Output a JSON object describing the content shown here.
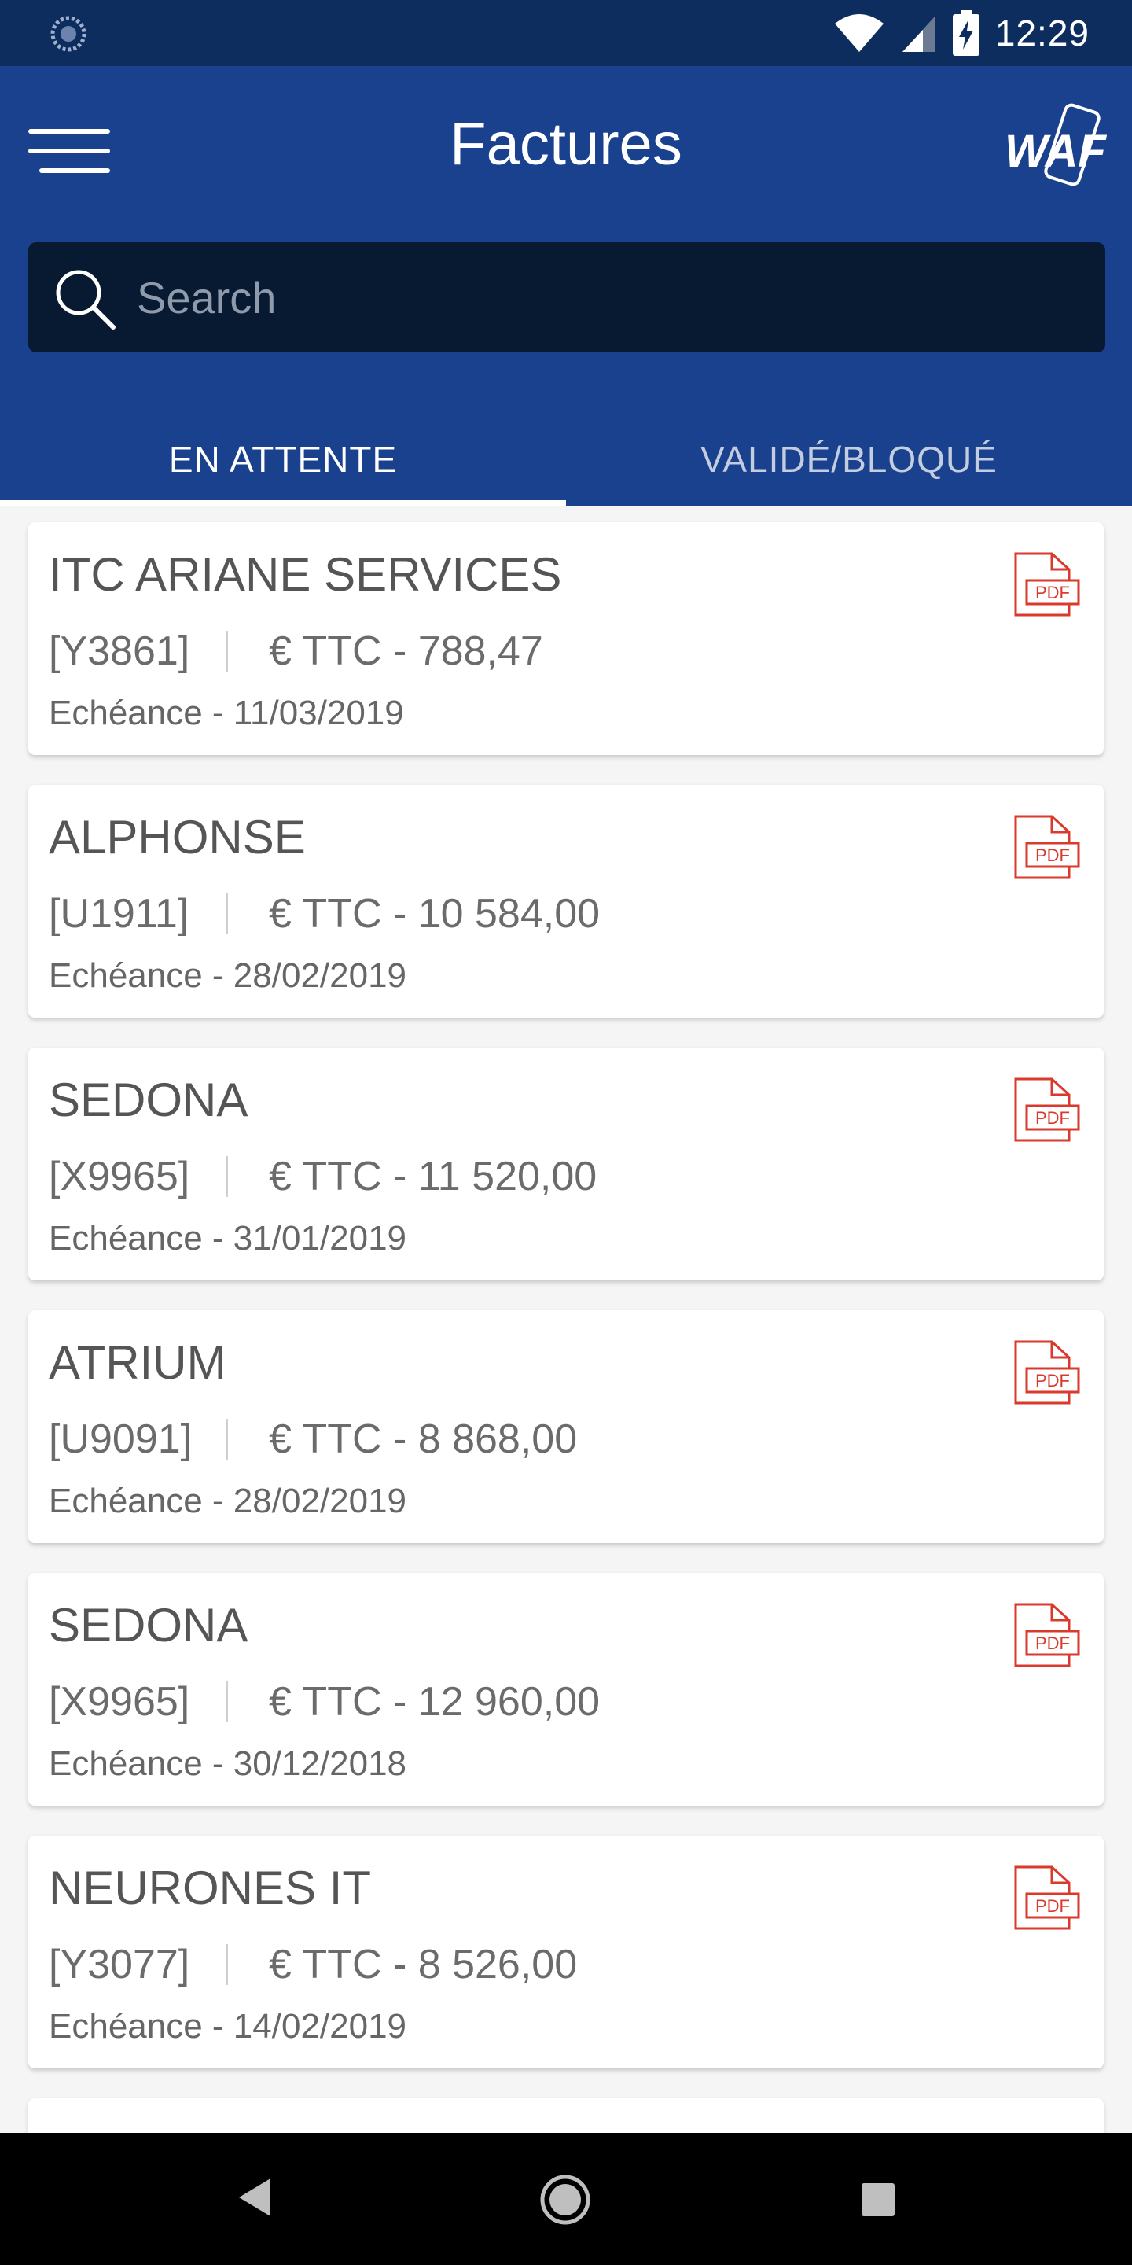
{
  "status_bar": {
    "time": "12:29",
    "icons": [
      "sync-icon",
      "wifi-icon",
      "signal-icon",
      "battery-charging-icon"
    ]
  },
  "app_bar": {
    "title": "Factures",
    "menu_icon": "hamburger-menu-icon",
    "logo_text": "WAF"
  },
  "search": {
    "placeholder": "Search",
    "value": ""
  },
  "tabs": [
    {
      "label": "EN ATTENTE",
      "active": true
    },
    {
      "label": "VALIDÉ/BLOQUÉ",
      "active": false
    }
  ],
  "invoices": [
    {
      "name": "ITC ARIANE SERVICES",
      "ref": "[Y3861]",
      "amount": "€ TTC - 788,47",
      "due": "Echéance - 11/03/2019"
    },
    {
      "name": "ALPHONSE",
      "ref": "[U1911]",
      "amount": "€ TTC - 10 584,00",
      "due": "Echéance - 28/02/2019"
    },
    {
      "name": "SEDONA",
      "ref": "[X9965]",
      "amount": "€ TTC - 11 520,00",
      "due": "Echéance - 31/01/2019"
    },
    {
      "name": "ATRIUM",
      "ref": "[U9091]",
      "amount": "€ TTC - 8 868,00",
      "due": "Echéance - 28/02/2019"
    },
    {
      "name": "SEDONA",
      "ref": "[X9965]",
      "amount": "€ TTC - 12 960,00",
      "due": "Echéance - 30/12/2018"
    },
    {
      "name": "NEURONES IT",
      "ref": "[Y3077]",
      "amount": "€ TTC - 8 526,00",
      "due": "Echéance - 14/02/2019"
    }
  ],
  "pdf_label": "PDF",
  "colors": {
    "status_bar": "#0d2d5e",
    "app_bar": "#1a418d",
    "search_bg": "#081a32",
    "pdf_red": "#d93a2b"
  },
  "nav_bar": {
    "icons": [
      "back-icon",
      "home-icon",
      "recents-icon"
    ]
  }
}
